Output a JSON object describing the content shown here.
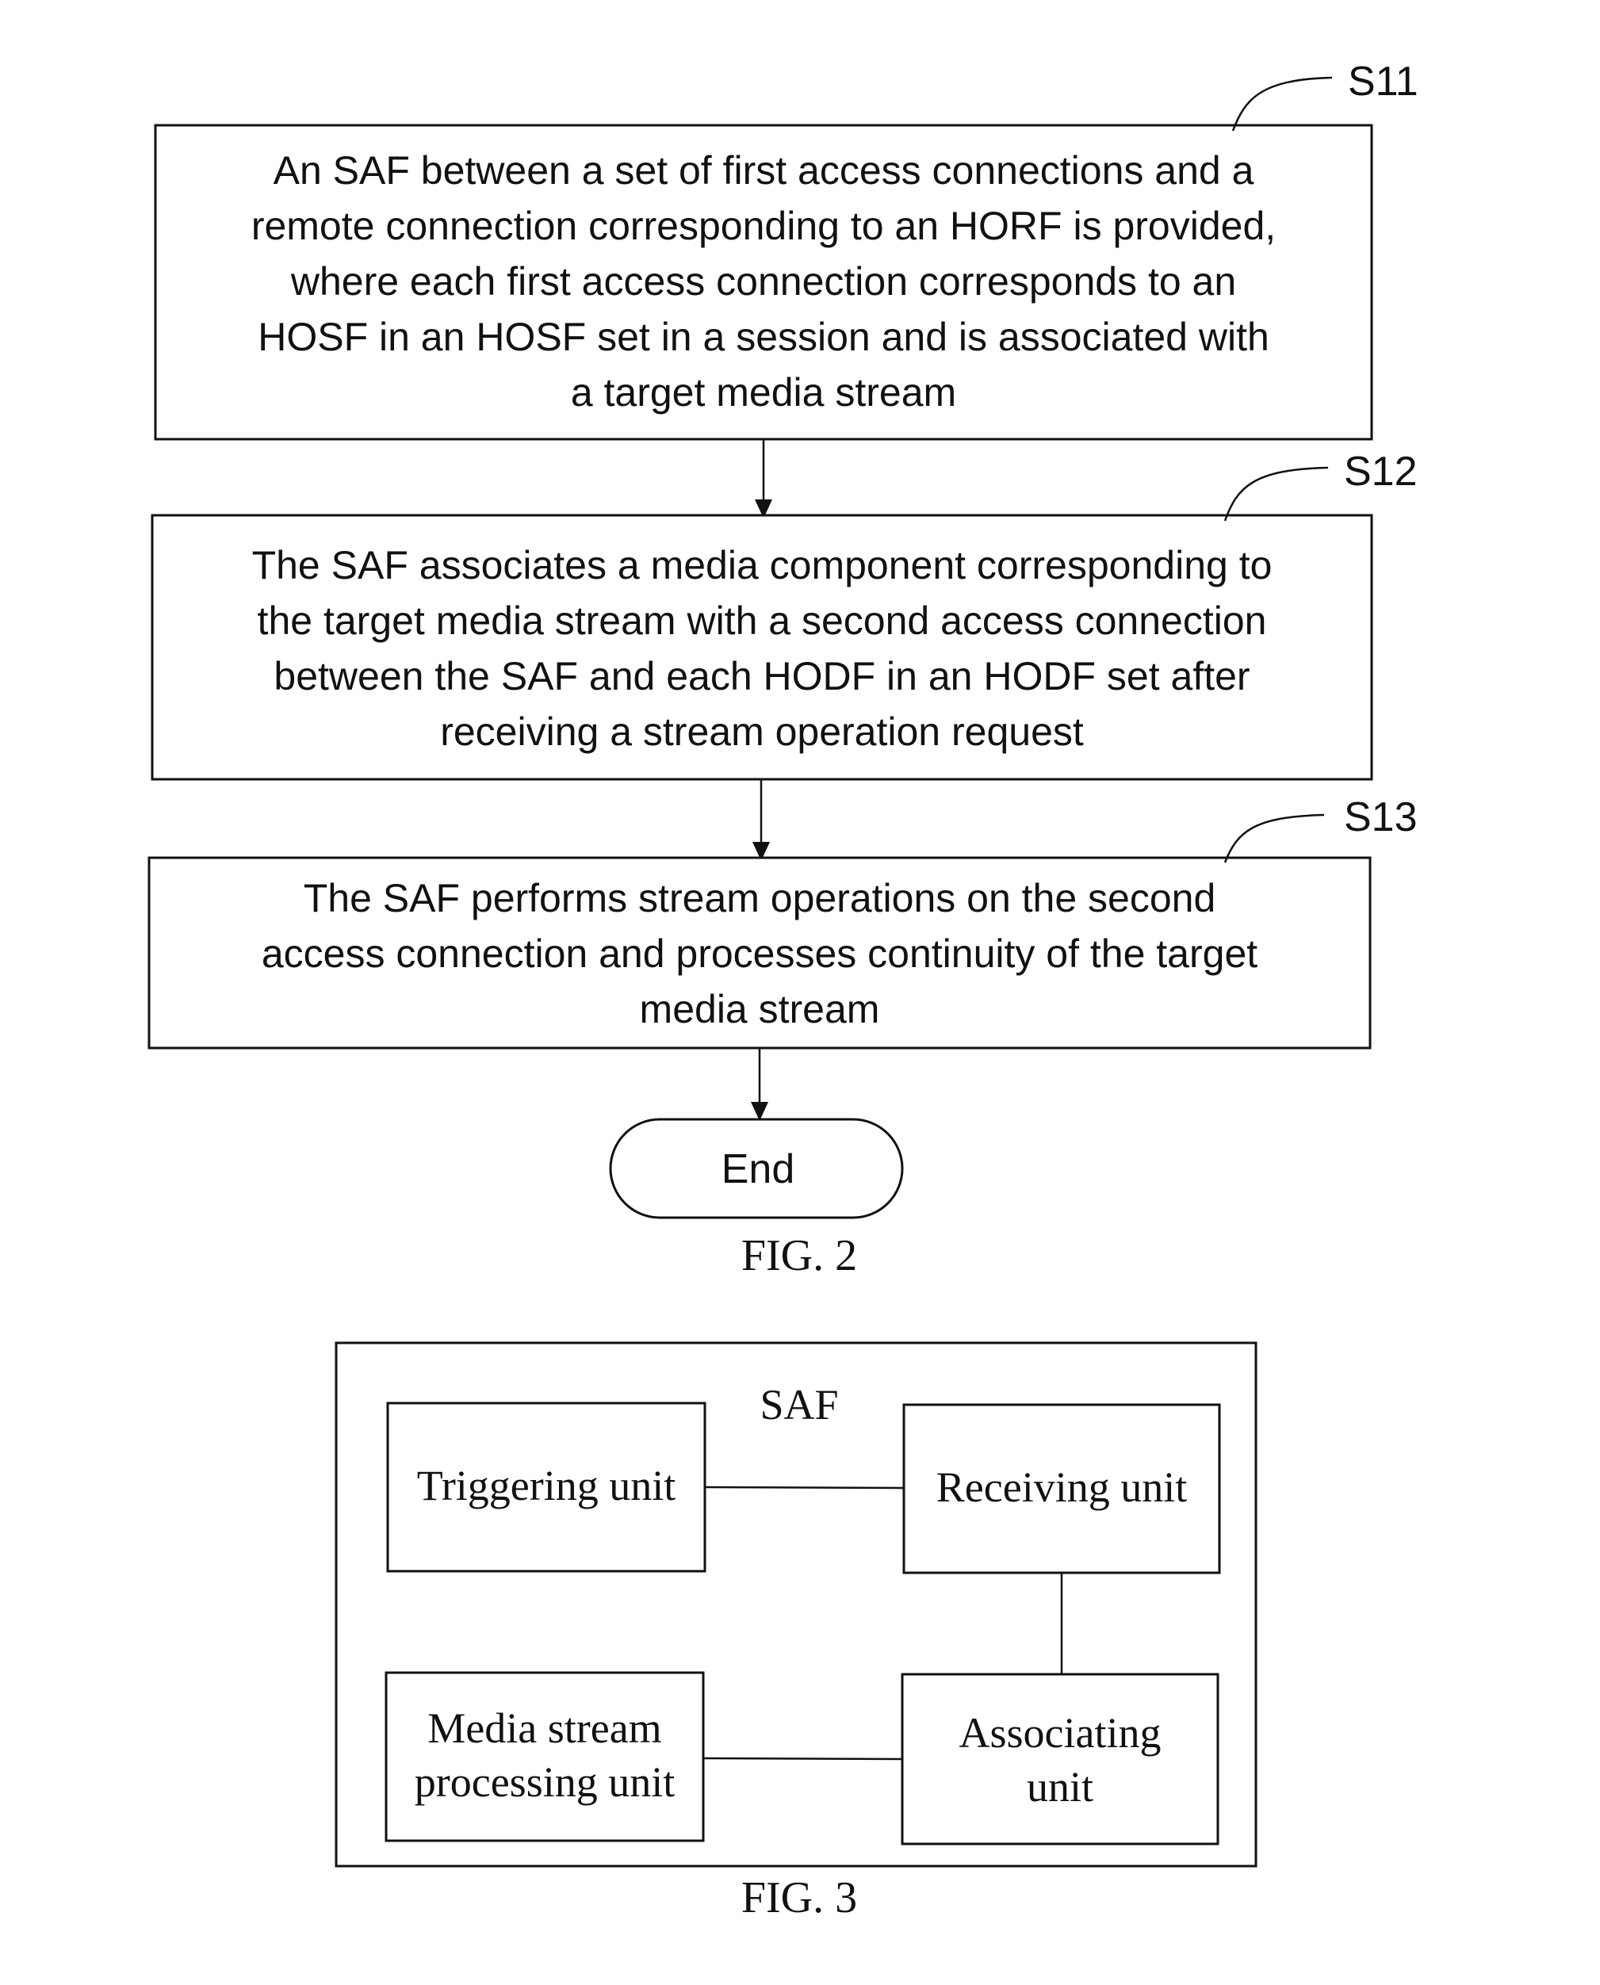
{
  "fig2": {
    "caption": "FIG. 2",
    "steps": [
      {
        "label": "S11",
        "lines": [
          "An SAF between a set of first access connections and a",
          "remote connection corresponding to an HORF is provided,",
          "where each first access connection corresponds to an",
          "HOSF in an HOSF set in a session and is associated with",
          "a target media stream"
        ]
      },
      {
        "label": "S12",
        "lines": [
          "The SAF associates a media component corresponding to",
          "the target media stream with a second access connection",
          "between the SAF and each HODF in an HODF set after",
          "receiving a stream operation request"
        ]
      },
      {
        "label": "S13",
        "lines": [
          "The SAF performs stream operations on the second",
          "access connection and processes continuity of the target",
          "media stream"
        ]
      }
    ],
    "end_label": "End"
  },
  "fig3": {
    "caption": "FIG. 3",
    "container_label": "SAF",
    "units": {
      "triggering": [
        "Triggering unit"
      ],
      "receiving": [
        "Receiving unit"
      ],
      "media_stream": [
        "Media stream",
        "processing unit"
      ],
      "associating": [
        "Associating",
        "unit"
      ]
    }
  }
}
